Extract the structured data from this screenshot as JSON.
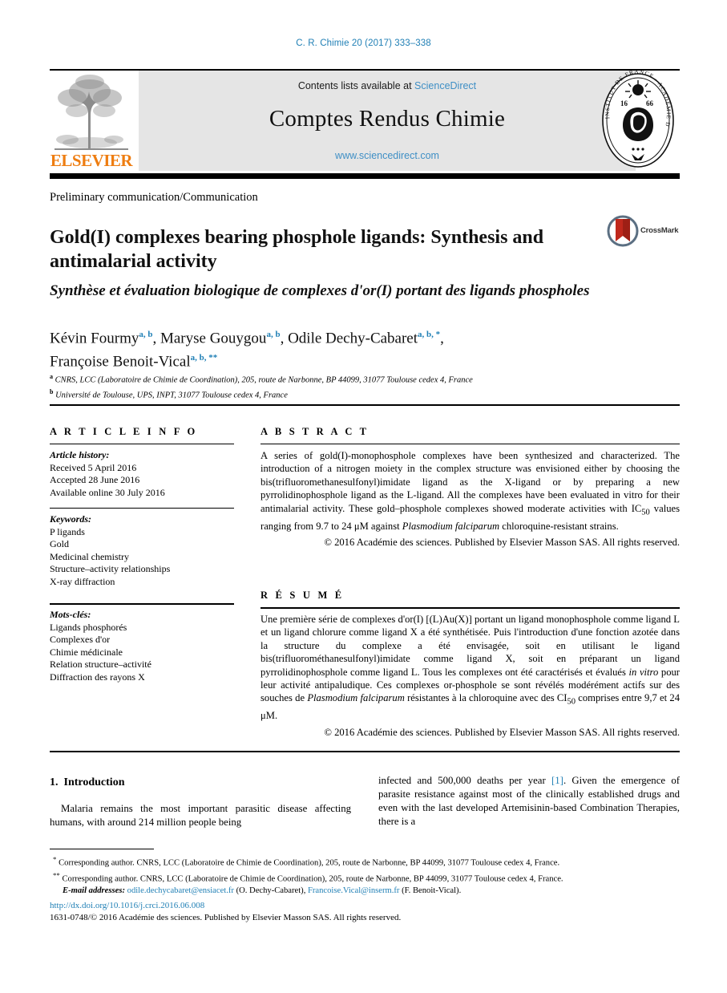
{
  "running_head": "C. R. Chimie 20 (2017) 333–338",
  "banner": {
    "publisher_logo_text": "ELSEVIER",
    "contents_prefix": "Contents lists available at",
    "contents_link": "ScienceDirect",
    "journal_title": "Comptes Rendus Chimie",
    "journal_url": "www.sciencedirect.com",
    "seal_text_outer": "INSTITUT DE FRANCE · ACADÉMIE DES SCIENCES",
    "seal_year": "1666"
  },
  "article": {
    "type": "Preliminary communication/Communication",
    "title_en": "Gold(I) complexes bearing phosphole ligands: Synthesis and antimalarial activity",
    "title_fr": "Synthèse et évaluation biologique de complexes d'or(I) portant des ligands phospholes",
    "crossmark_label": "CrossMark"
  },
  "authors": {
    "line1_a": "Kévin Fourmy",
    "line1_a_sup": "a, b",
    "line1_b": "Maryse Gouygou",
    "line1_b_sup": "a, b",
    "line1_c": "Odile Dechy-Cabaret",
    "line1_c_sup": "a, b, *",
    "line2_a": "Françoise Benoit-Vical",
    "line2_a_sup": "a, b, **",
    "affiliation_a_marker": "a",
    "affiliation_a": "CNRS, LCC (Laboratoire de Chimie de Coordination), 205, route de Narbonne, BP 44099, 31077 Toulouse cedex 4, France",
    "affiliation_b_marker": "b",
    "affiliation_b": "Université de Toulouse, UPS, INPT, 31077 Toulouse cedex 4, France"
  },
  "info": {
    "header": "A R T I C L E   I N F O",
    "history_label": "Article history:",
    "history": [
      "Received 5 April 2016",
      "Accepted 28 June 2016",
      "Available online 30 July 2016"
    ],
    "keywords_label": "Keywords:",
    "keywords": [
      "P ligands",
      "Gold",
      "Medicinal chemistry",
      "Structure–activity relationships",
      "X-ray diffraction"
    ],
    "motscles_label": "Mots-clés:",
    "motscles": [
      "Ligands phosphorés",
      "Complexes d'or",
      "Chimie médicinale",
      "Relation structure–activité",
      "Diffraction des rayons X"
    ]
  },
  "abstract": {
    "header": "A B S T R A C T",
    "text": "A series of gold(I)-monophosphole complexes have been synthesized and characterized. The introduction of a nitrogen moiety in the complex structure was envisioned either by choosing the bis(trifluoromethanesulfonyl)imidate ligand as the X-ligand or by preparing a new pyrrolidinophosphole ligand as the L-ligand. All the complexes have been evaluated in vitro for their antimalarial activity. These gold–phosphole complexes showed moderate activities with IC50 values ranging from 9.7 to 24 μM against Plasmodium falciparum chloroquine-resistant strains.",
    "copyright": "© 2016 Académie des sciences. Published by Elsevier Masson SAS. All rights reserved."
  },
  "resume": {
    "header": "R É S U M É",
    "text": "Une première série de complexes d'or(I) [(L)Au(X)] portant un ligand monophosphole comme ligand L et un ligand chlorure comme ligand X a été synthétisée. Puis l'introduction d'une fonction azotée dans la structure du complexe a été envisagée, soit en utilisant le ligand bis(trifluorométhanesulfonyl)imidate comme ligand X, soit en préparant un ligand pyrrolidinophosphole comme ligand L. Tous les complexes ont été caractérisés et évalués in vitro pour leur activité antipaludique. Ces complexes or-phosphole se sont révélés modérément actifs sur des souches de Plasmodium falciparum résistantes à la chloroquine avec des CI50 comprises entre 9,7 et 24 μM.",
    "copyright": "© 2016 Académie des sciences. Published by Elsevier Masson SAS. All rights reserved."
  },
  "body": {
    "section_number": "1.",
    "section_title": "Introduction",
    "left_paragraph": "Malaria remains the most important parasitic disease affecting humans, with around 214 million people being",
    "right_paragraph_part1": "infected and 500,000 deaths per year",
    "right_reference": "[1]",
    "right_paragraph_part2": ". Given the emergence of parasite resistance against most of the clinically established drugs and even with the last developed Artemisinin-based Combination Therapies, there is a"
  },
  "footnotes": {
    "star_marker": "*",
    "star_text": "Corresponding author. CNRS, LCC (Laboratoire de Chimie de Coordination), 205, route de Narbonne, BP 44099, 31077 Toulouse cedex 4, France.",
    "dstar_marker": "**",
    "dstar_text": "Corresponding author. CNRS, LCC (Laboratoire de Chimie de Coordination), 205, route de Narbonne, BP 44099, 31077 Toulouse cedex 4, France.",
    "email_label": "E-mail addresses:",
    "email1": "odile.dechycabaret@ensiacet.fr",
    "email1_owner": "(O. Dechy-Cabaret),",
    "email2": "Francoise.Vical@inserm.fr",
    "email2_owner": "(F. Benoit-Vical)."
  },
  "bottom": {
    "doi": "http://dx.doi.org/10.1016/j.crci.2016.06.008",
    "issn_line": "1631-0748/© 2016 Académie des sciences. Published by Elsevier Masson SAS. All rights reserved."
  },
  "colors": {
    "link_blue": "#1f7fb5",
    "sciencedirect_blue": "#3f8fc5",
    "elsevier_orange": "#ee7d11",
    "banner_grey": "#e5e5e5",
    "crossmark_red": "#c0281c"
  }
}
